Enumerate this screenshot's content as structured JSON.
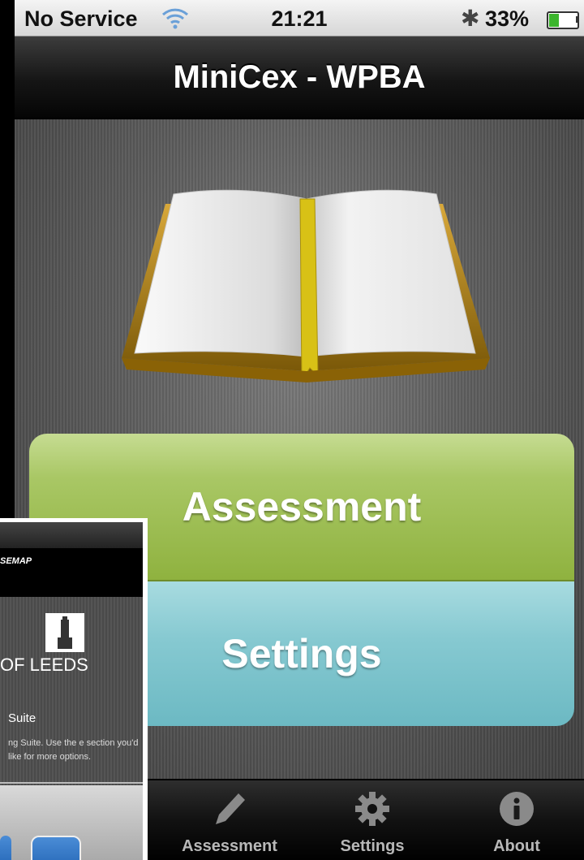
{
  "status_bar": {
    "carrier": "No Service",
    "time": "21:21",
    "battery": "33%",
    "battery_level": 0.33
  },
  "navbar": {
    "title": "MiniCex - WPBA"
  },
  "main": {
    "assessment_label": "Assessment",
    "settings_label": "Settings"
  },
  "tabbar": {
    "tabs": [
      {
        "label": "Assessment",
        "icon": "pencil-icon"
      },
      {
        "label": "Settings",
        "icon": "gear-icon"
      },
      {
        "label": "About",
        "icon": "info-icon"
      }
    ]
  },
  "inset": {
    "brand": "SEMAP",
    "org": "OF LEEDS",
    "suite_title": "Suite",
    "description": "ng Suite. Use the e section you'd like for more options."
  },
  "colors": {
    "assessment": "#a9c765",
    "settings": "#86c9d1",
    "book_gold": "#b88a16",
    "ribbon": "#d8c116"
  }
}
